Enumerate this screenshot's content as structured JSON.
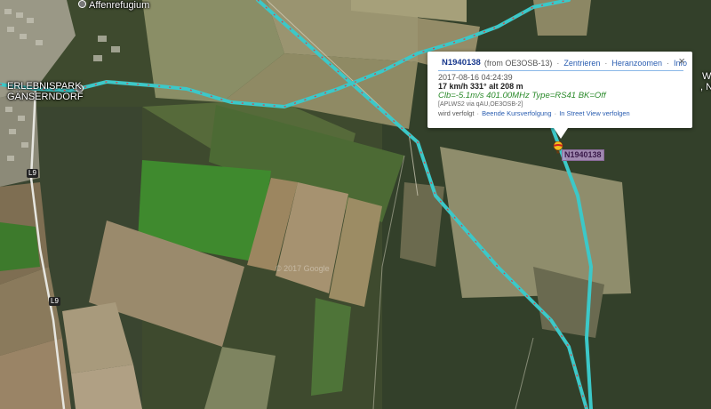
{
  "map": {
    "places": {
      "affenrefugium": "Affenrefugium",
      "erlebnispark_line1": "ERLEBNISPARK",
      "erlebnispark_line2": "GÄNSERNDORF",
      "edge_w": "W",
      "edge_n": ", N"
    },
    "roads": {
      "l9_north": "L9",
      "l9_south": "L9"
    },
    "watermark": "© 2017 Google",
    "colors": {
      "track": "#3cc8c8",
      "track_dash": "#d44",
      "highway": "#e8e8e8"
    }
  },
  "marker": {
    "label": "N1940138",
    "icon": "balloon-icon"
  },
  "popup": {
    "callsign": "N1940138",
    "from": "(from OE3OSB-13)",
    "links": [
      "Zentrieren",
      "Heranzoomen",
      "Info"
    ],
    "close": "×",
    "timestamp": "2017-08-16 04:24:39",
    "speed": "17 km/h 331° alt 208 m",
    "comment": "Clb=-5.1m/s 401.00MHz Type=RS41 BK=Off",
    "path": "[APLWS2 via qAU,OE3OSB-2]",
    "follow_prefix": "wird verfolgt",
    "follow_links": [
      "Beende Kursverfolgung",
      "In Street View verfolgen"
    ]
  }
}
